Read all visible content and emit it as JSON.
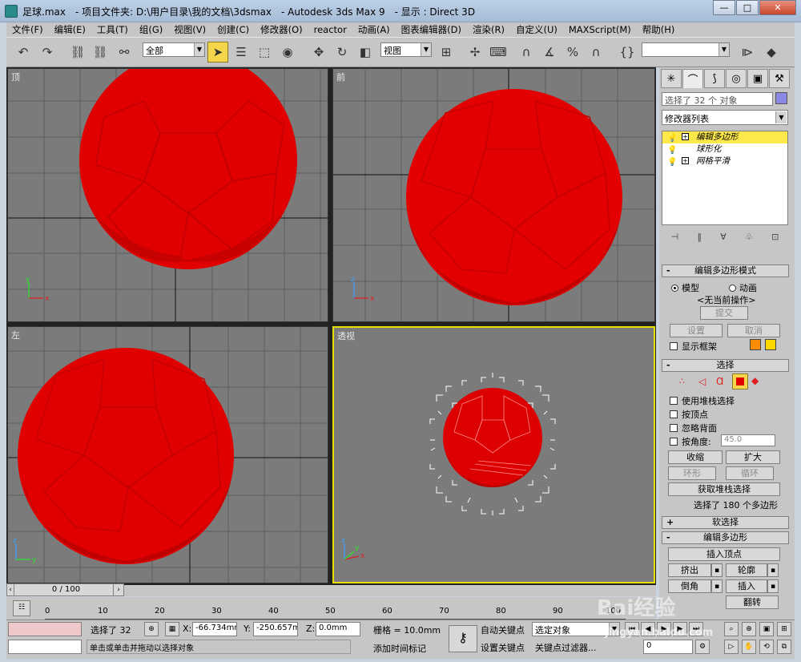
{
  "window": {
    "title": "足球.max　- 项目文件夹: D:\\用户目录\\我的文档\\3dsmax　- Autodesk 3ds Max 9　- 显示 : Direct 3D",
    "minimize": "—",
    "restore": "□",
    "close": "✕"
  },
  "menu": [
    "文件(F)",
    "编辑(E)",
    "工具(T)",
    "组(G)",
    "视图(V)",
    "创建(C)",
    "修改器(O)",
    "reactor",
    "动画(A)",
    "图表编辑器(D)",
    "渲染(R)",
    "自定义(U)",
    "MAXScript(M)",
    "帮助(H)"
  ],
  "toolbar": {
    "selection_filter": "全部",
    "ref_coord": "视图",
    "named_selection": ""
  },
  "viewports": [
    {
      "label": "顶",
      "active": false
    },
    {
      "label": "前",
      "active": false
    },
    {
      "label": "左",
      "active": false
    },
    {
      "label": "透视",
      "active": true
    }
  ],
  "axis": {
    "x": "x",
    "y": "y",
    "z": "z"
  },
  "cmd": {
    "tabs": [
      "create-icon",
      "modify-icon",
      "hierarchy-icon",
      "motion-icon",
      "display-icon",
      "utilities-icon"
    ],
    "selection_name": "选择了 32 个 对象",
    "object_color": "#8a8ae6",
    "modifier_list": "修改器列表",
    "stack": [
      "编辑多边形",
      "球形化",
      "网格平滑"
    ],
    "mode_rollout": {
      "title": "编辑多边形模式",
      "model": "模型",
      "animate": "动画",
      "no_op": "<无当前操作>",
      "commit": "提交",
      "settings": "设置",
      "cancel": "取消",
      "show_cage": "显示框架",
      "cage_color1": "#ff8c00",
      "cage_color2": "#ffd700"
    },
    "select_rollout": {
      "title": "选择",
      "by_stack": "使用堆栈选择",
      "by_vertex": "按顶点",
      "ignore_backfacing": "忽略背面",
      "by_angle": "按角度:",
      "angle_value": "45.0",
      "shrink": "收缩",
      "grow": "扩大",
      "ring": "环形",
      "loop": "循环",
      "get_stack_sel": "获取堆栈选择",
      "status": "选择了 180 个多边形"
    },
    "soft_select": {
      "title": "软选择"
    },
    "edit_poly": {
      "title": "编辑多边形",
      "insert_vertex": "插入顶点",
      "extrude": "挤出",
      "outline": "轮廓",
      "bevel": "倒角",
      "inset": "插入",
      "flip": "翻转"
    }
  },
  "time": {
    "slider": "0 / 100",
    "ticks": [
      "0",
      "10",
      "20",
      "30",
      "40",
      "50",
      "60",
      "70",
      "80",
      "90",
      "100"
    ]
  },
  "status": {
    "selected": "选择了 32",
    "prompt": "单击或单击并拖动以选择对象",
    "x_label": "X:",
    "x_value": "-66.734mm",
    "y_label": "Y:",
    "y_value": "-250.657mm",
    "z_label": "Z:",
    "z_value": "0.0mm",
    "grid": "栅格 = 10.0mm",
    "add_time_tag": "添加时间标记",
    "auto_key": "自动关键点",
    "set_key": "设置关键点",
    "key_mode": "选定对象",
    "key_filters": "关键点过滤器...",
    "frame": "0"
  },
  "watermark": {
    "brand": "Bai经验",
    "url": "jingyan.baidu.com"
  }
}
